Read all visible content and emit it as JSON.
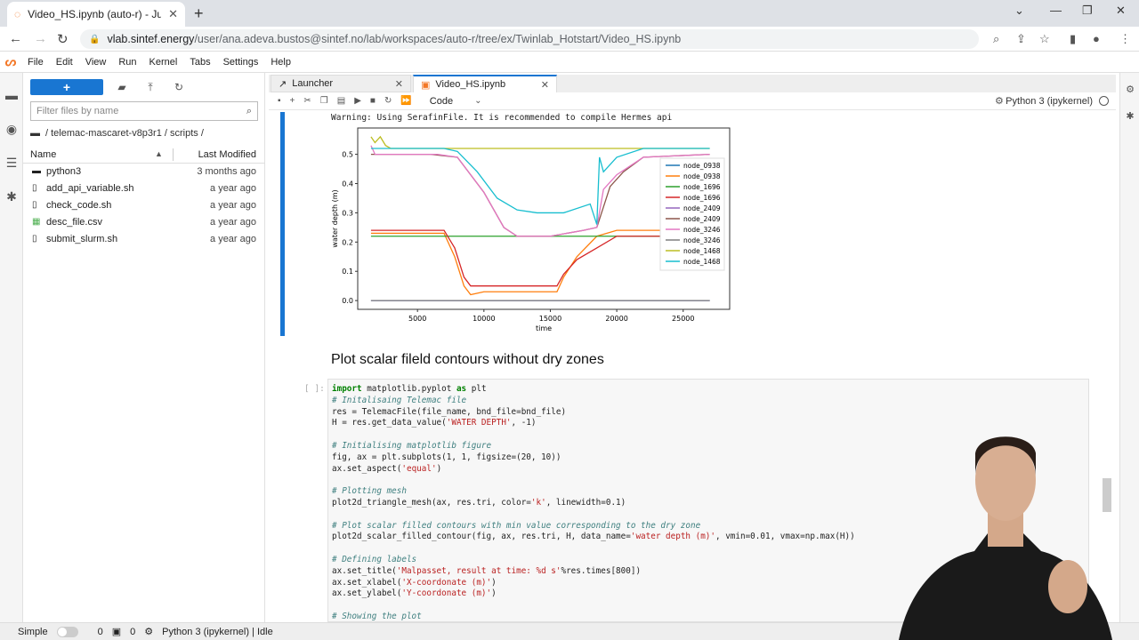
{
  "browser": {
    "tab_title": "Video_HS.ipynb (auto-r) - Jupyter",
    "url_domain": "vlab.sintef.energy",
    "url_path": "/user/ana.adeva.bustos@sintef.no/lab/workspaces/auto-r/tree/ex/Twinlab_Hotstart/Video_HS.ipynb"
  },
  "menu": [
    "File",
    "Edit",
    "View",
    "Run",
    "Kernel",
    "Tabs",
    "Settings",
    "Help"
  ],
  "file_browser": {
    "new_label": "+",
    "filter_placeholder": "Filter files by name",
    "breadcrumb": "/ telemac-mascaret-v8p3r1 / scripts /",
    "col_name": "Name",
    "col_modified": "Last Modified",
    "files": [
      {
        "name": "python3",
        "modified": "3 months ago",
        "icon": "folder-icon"
      },
      {
        "name": "add_api_variable.sh",
        "modified": "a year ago",
        "icon": "file-icon"
      },
      {
        "name": "check_code.sh",
        "modified": "a year ago",
        "icon": "file-icon"
      },
      {
        "name": "desc_file.csv",
        "modified": "a year ago",
        "icon": "spreadsheet-icon"
      },
      {
        "name": "submit_slurm.sh",
        "modified": "a year ago",
        "icon": "file-icon"
      }
    ]
  },
  "doc_tabs": [
    {
      "label": "Launcher"
    },
    {
      "label": "Video_HS.ipynb"
    }
  ],
  "toolbar": {
    "cell_type": "Code",
    "kernel": "Python 3 (ipykernel)"
  },
  "output": {
    "warning": "Warning: Using SerafinFile. It is recommended to compile Hermes api"
  },
  "chart_data": {
    "type": "line",
    "xlabel": "time",
    "ylabel": "water depth (m)",
    "xlim": [
      500,
      28500
    ],
    "ylim": [
      -0.03,
      0.59
    ],
    "xticks": [
      5000,
      10000,
      15000,
      20000,
      25000
    ],
    "yticks": [
      0.0,
      0.1,
      0.2,
      0.3,
      0.4,
      0.5
    ],
    "legend_position": "right",
    "series": [
      {
        "name": "node_0938",
        "color": "#1f77b4",
        "x": [
          1500,
          7000,
          27000
        ],
        "y": [
          0.0,
          0.0,
          0.0
        ]
      },
      {
        "name": "node_0938",
        "color": "#ff7f0e",
        "x": [
          1500,
          7000,
          7800,
          8500,
          9000,
          10000,
          12000,
          14000,
          15500,
          16000,
          17000,
          18500,
          20000,
          27000
        ],
        "y": [
          0.23,
          0.23,
          0.15,
          0.05,
          0.02,
          0.03,
          0.03,
          0.03,
          0.03,
          0.08,
          0.15,
          0.22,
          0.24,
          0.24
        ]
      },
      {
        "name": "node_1696",
        "color": "#2ca02c",
        "x": [
          1500,
          7000,
          27000
        ],
        "y": [
          0.22,
          0.22,
          0.22
        ]
      },
      {
        "name": "node_1696",
        "color": "#d62728",
        "x": [
          1500,
          7000,
          7800,
          8500,
          9000,
          10000,
          12000,
          14000,
          15500,
          16000,
          17000,
          18500,
          20000,
          27000
        ],
        "y": [
          0.24,
          0.24,
          0.18,
          0.08,
          0.05,
          0.05,
          0.05,
          0.05,
          0.05,
          0.09,
          0.14,
          0.18,
          0.22,
          0.22
        ]
      },
      {
        "name": "node_2409",
        "color": "#9467bd",
        "x": [
          1500,
          27000
        ],
        "y": [
          0.0,
          0.0
        ]
      },
      {
        "name": "node_2409",
        "color": "#8c564b",
        "x": [
          1500,
          6000,
          8000,
          10000,
          11500,
          12500,
          15000,
          17500,
          18500,
          19500,
          20500,
          22000,
          27000
        ],
        "y": [
          0.5,
          0.5,
          0.49,
          0.37,
          0.25,
          0.22,
          0.22,
          0.24,
          0.25,
          0.39,
          0.44,
          0.49,
          0.5
        ]
      },
      {
        "name": "node_3246",
        "color": "#e377c2",
        "x": [
          1500,
          1800,
          2500,
          6500,
          8000,
          10000,
          11500,
          12500,
          15000,
          17500,
          18500,
          19000,
          20000,
          22000,
          27000
        ],
        "y": [
          0.53,
          0.5,
          0.5,
          0.5,
          0.49,
          0.37,
          0.25,
          0.22,
          0.22,
          0.24,
          0.25,
          0.38,
          0.43,
          0.49,
          0.5
        ]
      },
      {
        "name": "node_3246",
        "color": "#7f7f7f",
        "x": [
          1500,
          27000
        ],
        "y": [
          0.0,
          0.0
        ]
      },
      {
        "name": "node_1468",
        "color": "#bcbd22",
        "x": [
          1500,
          1800,
          2200,
          2600,
          3000,
          7000,
          27000
        ],
        "y": [
          0.56,
          0.54,
          0.56,
          0.53,
          0.52,
          0.52,
          0.52
        ]
      },
      {
        "name": "node_1468",
        "color": "#17becf",
        "x": [
          1500,
          7000,
          8000,
          9500,
          11000,
          12500,
          14000,
          16000,
          18000,
          18500,
          18700,
          19000,
          20000,
          22000,
          27000
        ],
        "y": [
          0.52,
          0.52,
          0.51,
          0.44,
          0.35,
          0.31,
          0.3,
          0.3,
          0.33,
          0.26,
          0.49,
          0.44,
          0.49,
          0.52,
          0.52
        ]
      }
    ]
  },
  "markdown_heading": "Plot scalar fileld contours without dry zones",
  "code_prompt": "[ ]:",
  "code_lines": [
    "import matplotlib.pyplot as plt",
    "# Initalisaing Telemac file",
    "res = TelemacFile(file_name, bnd_file=bnd_file)",
    "H = res.get_data_value('WATER DEPTH', -1)",
    "",
    "# Initialising matplotlib figure",
    "fig, ax = plt.subplots(1, 1, figsize=(20, 10))",
    "ax.set_aspect('equal')",
    "",
    "# Plotting mesh",
    "plot2d_triangle_mesh(ax, res.tri, color='k', linewidth=0.1)",
    "",
    "# Plot scalar filled contours with min value corresponding to the dry zone",
    "plot2d_scalar_filled_contour(fig, ax, res.tri, H, data_name='water depth (m)', vmin=0.01, vmax=np.max(H))",
    "",
    "# Defining labels",
    "ax.set_title('Malpasset, result at time: %d s'%res.times[800])",
    "ax.set_xlabel('X-coordonate (m)')",
    "ax.set_ylabel('Y-coordonate (m)')",
    "",
    "# Showing the plot"
  ],
  "status": {
    "mode": "Simple",
    "count1": "0",
    "count2": "0",
    "kernel_status": "Python 3 (ipykernel) | Idle"
  }
}
